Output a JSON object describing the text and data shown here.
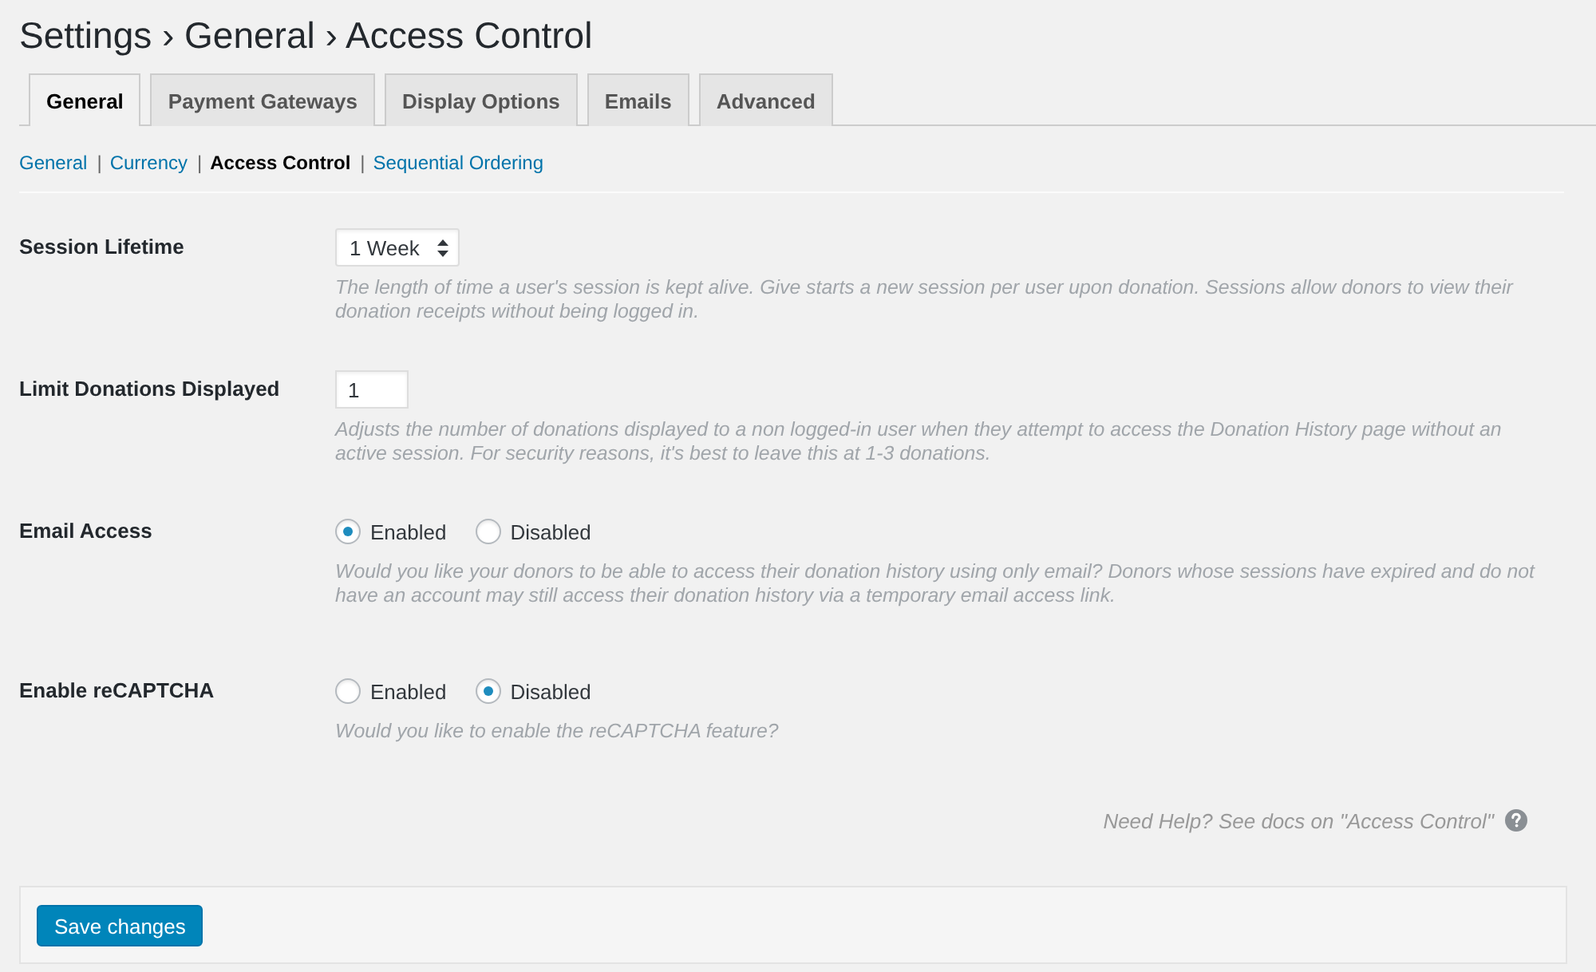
{
  "page_title": "Settings › General › Access Control",
  "tabs": [
    {
      "label": "General",
      "selected": true
    },
    {
      "label": "Payment Gateways",
      "selected": false
    },
    {
      "label": "Display Options",
      "selected": false
    },
    {
      "label": "Emails",
      "selected": false
    },
    {
      "label": "Advanced",
      "selected": false
    }
  ],
  "subnav": {
    "items": [
      {
        "label": "General",
        "selected": false
      },
      {
        "label": "Currency",
        "selected": false
      },
      {
        "label": "Access Control",
        "selected": true
      },
      {
        "label": "Sequential Ordering",
        "selected": false
      }
    ],
    "separators": [
      "|",
      "|",
      "|"
    ]
  },
  "settings": [
    {
      "kind": "select",
      "label": "Session Lifetime",
      "value": "1 Week",
      "description": "The length of time a user's session is kept alive. Give starts a new session per user upon donation. Sessions allow donors to view their donation receipts without being logged in."
    },
    {
      "kind": "number",
      "label": "Limit Donations Displayed",
      "value": "1",
      "description": "Adjusts the number of donations displayed to a non logged-in user when they attempt to access the Donation History page without an active session. For security reasons, it's best to leave this at 1-3 donations."
    },
    {
      "kind": "radio",
      "label": "Email Access",
      "options": [
        {
          "label": "Enabled",
          "selected": true
        },
        {
          "label": "Disabled",
          "selected": false
        }
      ],
      "description": "Would you like your donors to be able to access their donation history using only email? Donors whose sessions have expired and do not have an account may still access their donation history via a temporary email access link."
    },
    {
      "kind": "radio",
      "label": "Enable reCAPTCHA",
      "options": [
        {
          "label": "Enabled",
          "selected": false
        },
        {
          "label": "Disabled",
          "selected": true
        }
      ],
      "description": "Would you like to enable the reCAPTCHA feature?"
    }
  ],
  "help_text": "Need Help? See docs on \"Access Control\"",
  "save_button": "Save changes"
}
